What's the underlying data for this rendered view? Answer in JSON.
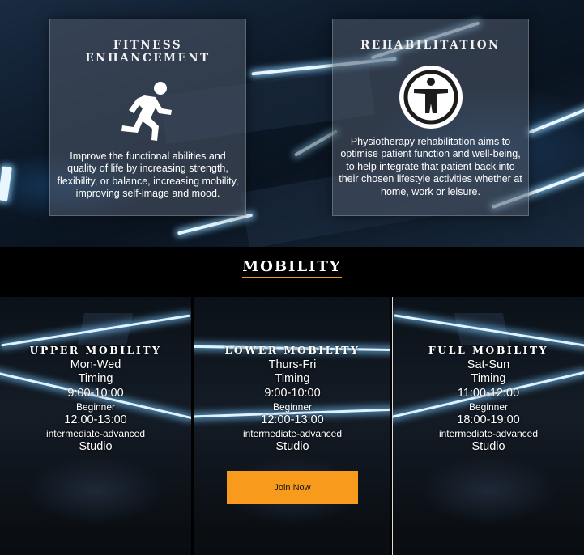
{
  "hero": {
    "cards": [
      {
        "title": "FITNESS ENHANCEMENT",
        "icon": "running-person-icon",
        "text": "Improve the functional abilities and quality of life by increasing strength, flexibility, or balance, increasing mobility, improving self-image and mood."
      },
      {
        "title": "REHABILITATION",
        "icon": "accessibility-person-icon",
        "text": "Physiotherapy rehabilitation aims to optimise patient function and well-being, to help integrate that patient back into their chosen lifestyle activities whether at home, work or leisure."
      }
    ]
  },
  "mobility": {
    "title": "MOBILITY",
    "accent_color": "#f09a1c",
    "columns": [
      {
        "title": "UPPER MOBILITY",
        "days": "Mon-Wed",
        "timing_label": "Timing",
        "slot1": "9:00-10:00",
        "level1": "Beginner",
        "slot2": "12:00-13:00",
        "level2": "intermediate-advanced",
        "location": "Studio"
      },
      {
        "title": "LOWER MOBILITY",
        "days": "Thurs-Fri",
        "timing_label": "Timing",
        "slot1": "9:00-10:00",
        "level1": "Beginner",
        "slot2": "12:00-13:00",
        "level2": "intermediate-advanced",
        "location": "Studio",
        "button": "Join Now"
      },
      {
        "title": "FULL MOBILITY",
        "days": "Sat-Sun",
        "timing_label": "Timing",
        "slot1": "11:00-12:00",
        "level1": "Beginner",
        "slot2": "18:00-19:00",
        "level2": "intermediate-advanced",
        "location": "Studio"
      }
    ],
    "button_color": "#f89a1c"
  }
}
